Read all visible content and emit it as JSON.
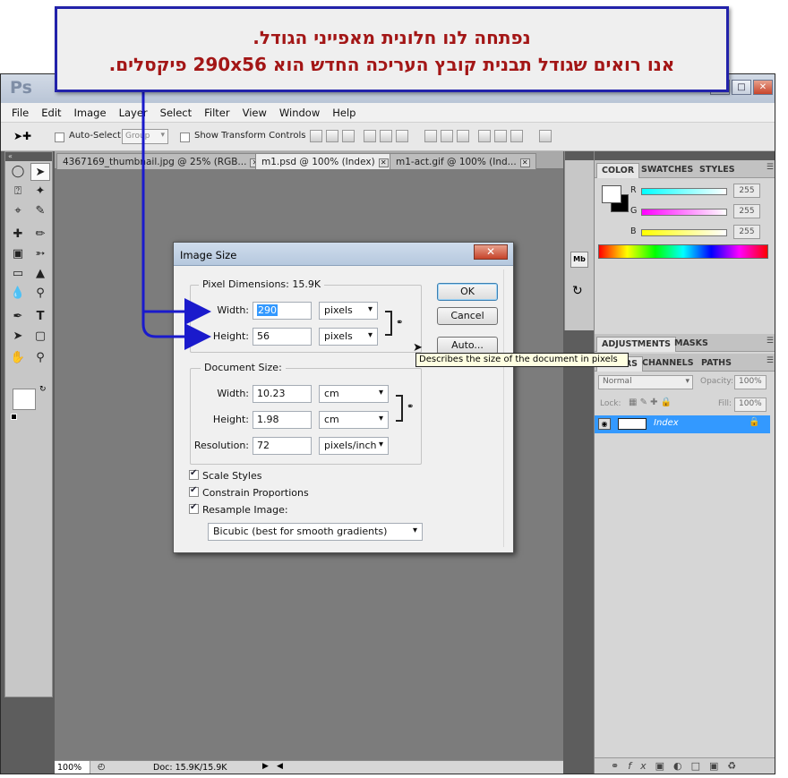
{
  "callout": {
    "line1": "נפתחה לנו חלונית מאפייני הגודל.",
    "line2": "אנו רואים שגודל תבנית קובץ העריכה החדש הוא 290x56 פיקסלים."
  },
  "app": {
    "logo": "Ps",
    "menus": [
      "File",
      "Edit",
      "Image",
      "Layer",
      "Select",
      "Filter",
      "View",
      "Window",
      "Help"
    ],
    "options": {
      "auto_select_label": "Auto-Select:",
      "auto_select_value": "Group",
      "transform_label": "Show Transform Controls"
    },
    "tabs": [
      {
        "label": "4367169_thumbnail.jpg @ 25% (RGB..."
      },
      {
        "label": "m1.psd @ 100% (Index)"
      },
      {
        "label": "m1-act.gif @ 100% (Ind..."
      }
    ],
    "status": {
      "zoom": "100%",
      "doc": "Doc: 15.9K/15.9K"
    }
  },
  "panels": {
    "color_tabs": [
      "COLOR",
      "SWATCHES",
      "STYLES"
    ],
    "channels": [
      {
        "letter": "R",
        "value": "255"
      },
      {
        "letter": "G",
        "value": "255"
      },
      {
        "letter": "B",
        "value": "255"
      }
    ],
    "adj_tabs": [
      "ADJUSTMENTS",
      "MASKS"
    ],
    "layer_tabs": [
      "LAYERS",
      "CHANNELS",
      "PATHS"
    ],
    "blend_mode": "Normal",
    "opacity_label": "Opacity:",
    "opacity_value": "100%",
    "lock_label": "Lock:",
    "fill_label": "Fill:",
    "fill_value": "100%",
    "layer_name": "Index",
    "strip_label": "Mb"
  },
  "dialog": {
    "title": "Image Size",
    "pixel_dimensions_label": "Pixel Dimensions:",
    "pixel_dimensions_size": "15.9K",
    "width_label": "Width:",
    "width_value": "290",
    "width_unit": "pixels",
    "height_label": "Height:",
    "height_value": "56",
    "height_unit": "pixels",
    "document_size_label": "Document Size:",
    "doc_width_label": "Width:",
    "doc_width_value": "10.23",
    "doc_width_unit": "cm",
    "doc_height_label": "Height:",
    "doc_height_value": "1.98",
    "doc_height_unit": "cm",
    "resolution_label": "Resolution:",
    "resolution_value": "72",
    "resolution_unit": "pixels/inch",
    "scale_styles": "Scale Styles",
    "constrain_proportions": "Constrain Proportions",
    "resample_image": "Resample Image:",
    "resample_method": "Bicubic (best for smooth gradients)",
    "ok": "OK",
    "cancel": "Cancel",
    "auto": "Auto...",
    "tooltip": "Describes the size of the document in pixels"
  },
  "colors": {
    "accent": "#3399ff",
    "arrow": "#1a1acc",
    "callout_text": "#a31616"
  }
}
